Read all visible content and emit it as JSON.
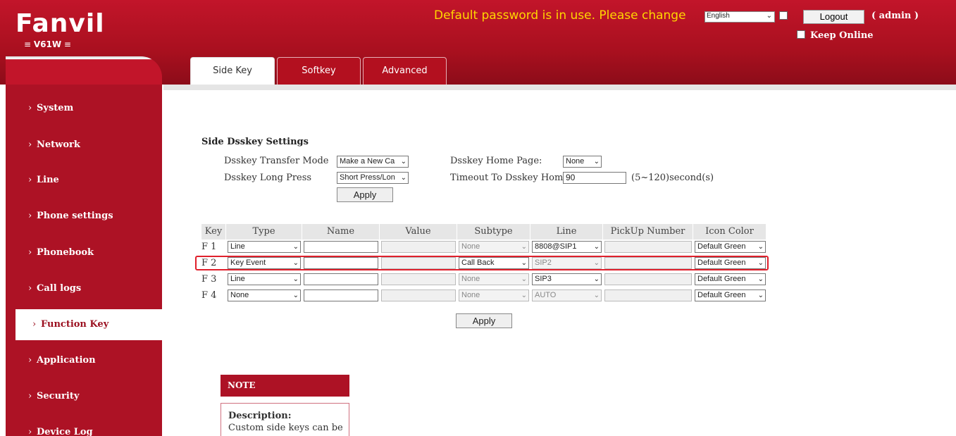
{
  "header": {
    "logo_text": "Fanvil",
    "model": "V61W",
    "warning": "Default password is in use. Please change",
    "language": "English",
    "logout_label": "Logout",
    "user_label": "( admin )",
    "keep_online_label": "Keep Online",
    "brand_color": "#ad1225"
  },
  "sidebar": {
    "items": [
      {
        "label": "System"
      },
      {
        "label": "Network"
      },
      {
        "label": "Line"
      },
      {
        "label": "Phone settings"
      },
      {
        "label": "Phonebook"
      },
      {
        "label": "Call logs"
      },
      {
        "label": "Function Key",
        "active": true
      },
      {
        "label": "Application"
      },
      {
        "label": "Security"
      },
      {
        "label": "Device Log"
      }
    ]
  },
  "tabs": [
    {
      "label": "Side Key",
      "active": true
    },
    {
      "label": "Softkey"
    },
    {
      "label": "Advanced"
    }
  ],
  "settings": {
    "title": "Side Dsskey Settings",
    "transfer_mode_label": "Dsskey Transfer Mode",
    "transfer_mode_value": "Make a New Ca",
    "long_press_label": "Dsskey Long Press",
    "long_press_value": "Short Press/Lon",
    "home_page_label": "Dsskey Home Page:",
    "home_page_value": "None",
    "timeout_label": "Timeout To Dsskey Home",
    "timeout_value": "90",
    "timeout_hint": "(5~120)second(s)",
    "apply_label": "Apply"
  },
  "table": {
    "headers": [
      "Key",
      "Type",
      "Name",
      "Value",
      "Subtype",
      "Line",
      "PickUp Number",
      "Icon Color"
    ],
    "rows": [
      {
        "key": "F 1",
        "type": "Line",
        "name": "",
        "value": "",
        "subtype": "None",
        "line": "8808@SIP1",
        "pickup": "",
        "icon_color": "Default Green"
      },
      {
        "key": "F 2",
        "type": "Key Event",
        "name": "",
        "value": "",
        "subtype": "Call Back",
        "line": "SIP2",
        "pickup": "",
        "icon_color": "Default Green"
      },
      {
        "key": "F 3",
        "type": "Line",
        "name": "",
        "value": "",
        "subtype": "None",
        "line": "SIP3",
        "pickup": "",
        "icon_color": "Default Green"
      },
      {
        "key": "F 4",
        "type": "None",
        "name": "",
        "value": "",
        "subtype": "None",
        "line": "AUTO",
        "pickup": "",
        "icon_color": "Default Green"
      }
    ],
    "apply_label": "Apply",
    "highlight_color": "#e0202c"
  },
  "note": {
    "title": "NOTE",
    "description_title": "Description:",
    "description_text": "Custom side keys can be"
  }
}
